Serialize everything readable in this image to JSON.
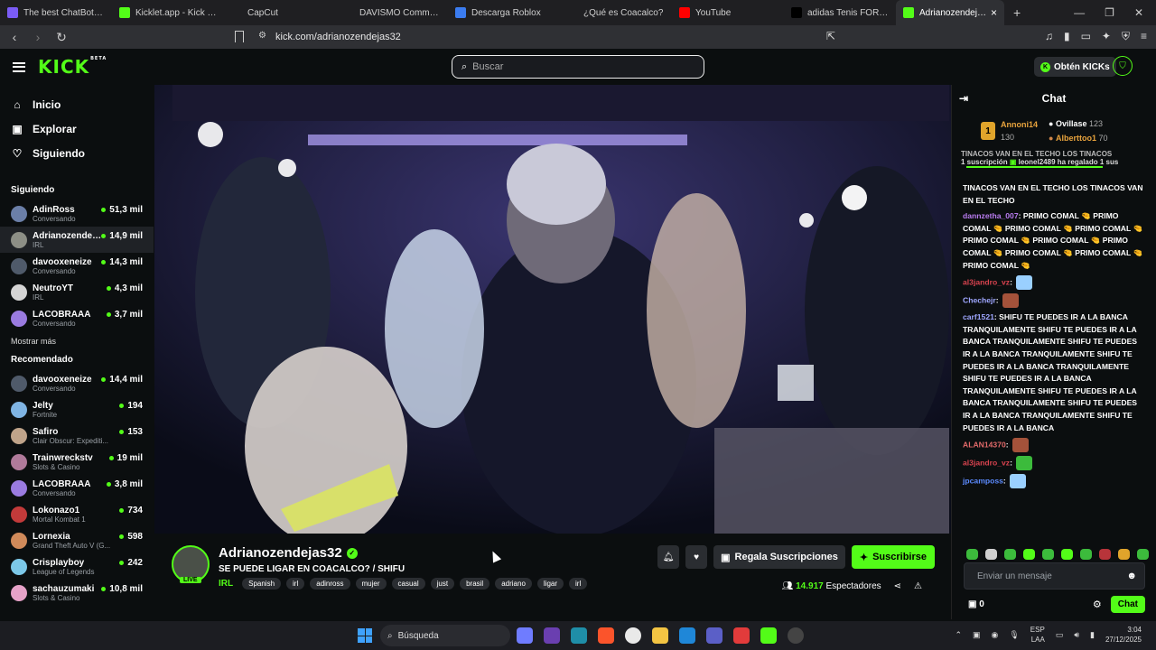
{
  "browser": {
    "tabs": [
      {
        "title": "The best ChatBot and Wi",
        "icon": "chatbot-icon",
        "color": "#7b5cf5"
      },
      {
        "title": "Kicklet.app - Kick Chatbo",
        "icon": "kicklet-icon",
        "color": "#53fc18"
      },
      {
        "title": "CapCut",
        "icon": "capcut-icon",
        "color": "#ffffff"
      },
      {
        "title": "DAVISMO Community / X",
        "icon": "x-icon",
        "color": "#ffffff"
      },
      {
        "title": "Descarga Roblox",
        "icon": "roblox-icon",
        "color": "#3b7cf0"
      },
      {
        "title": "¿Qué es Coacalco?",
        "icon": "ai-icon",
        "color": "#d0d0d0"
      },
      {
        "title": "YouTube",
        "icon": "youtube-icon",
        "color": "#ff0000"
      },
      {
        "title": "adidas Tenis FORUM2000",
        "icon": "adidas-icon",
        "color": "#000000"
      },
      {
        "title": "Adrianozendejas3",
        "icon": "kick-icon",
        "color": "#53fc18",
        "active": true
      }
    ],
    "url": "kick.com/adrianozendejas32"
  },
  "header": {
    "logo": "KICK",
    "logo_sup": "BETA",
    "search_placeholder": "Buscar",
    "get_kicks": "Obtén KICKs"
  },
  "sidebar": {
    "nav": [
      {
        "label": "Inicio",
        "icon": "home-icon"
      },
      {
        "label": "Explorar",
        "icon": "browse-icon"
      },
      {
        "label": "Siguiendo",
        "icon": "heart-icon"
      }
    ],
    "following_title": "Siguiendo",
    "following": [
      {
        "name": "AdinRoss",
        "category": "Conversando",
        "viewers": "51,3 mil",
        "color": "#6b7fa8"
      },
      {
        "name": "Adrianozendejas32",
        "category": "IRL",
        "viewers": "14,9 mil",
        "color": "#8d8f86",
        "selected": true
      },
      {
        "name": "davooxeneize",
        "category": "Conversando",
        "viewers": "14,3 mil",
        "color": "#4f5a6a"
      },
      {
        "name": "NeutroYT",
        "category": "IRL",
        "viewers": "4,3 mil",
        "color": "#d4d4d4"
      },
      {
        "name": "LACOBRAAA",
        "category": "Conversando",
        "viewers": "3,7 mil",
        "color": "#9a7be0"
      }
    ],
    "show_more": "Mostrar más",
    "recommended_title": "Recomendado",
    "recommended": [
      {
        "name": "davooxeneize",
        "category": "Conversando",
        "viewers": "14,4 mil",
        "color": "#4f5a6a"
      },
      {
        "name": "Jelty",
        "category": "Fortnite",
        "viewers": "194",
        "color": "#7fb4e3"
      },
      {
        "name": "Safiro",
        "category": "Clair Obscur: Expediti...",
        "viewers": "153",
        "color": "#c0a48a"
      },
      {
        "name": "Trainwreckstv",
        "category": "Slots & Casino",
        "viewers": "19 mil",
        "color": "#b07a9a"
      },
      {
        "name": "LACOBRAAA",
        "category": "Conversando",
        "viewers": "3,8 mil",
        "color": "#9a7be0"
      },
      {
        "name": "Lokonazo1",
        "category": "Mortal Kombat 1",
        "viewers": "734",
        "color": "#c23a3a"
      },
      {
        "name": "Lornexia",
        "category": "Grand Theft Auto V (G...",
        "viewers": "598",
        "color": "#d08a5a"
      },
      {
        "name": "Crisplayboy",
        "category": "League of Legends",
        "viewers": "242",
        "color": "#7cc8e8"
      },
      {
        "name": "sachauzumaki",
        "category": "Slots & Casino",
        "viewers": "10,8 mil",
        "color": "#e6a2c8"
      }
    ]
  },
  "stream": {
    "streamer": "Adrianozendejas32",
    "live": "LIVE",
    "title": "SE PUEDE LIGAR EN COACALCO? / SHIFU",
    "category": "IRL",
    "tags": [
      "Spanish",
      "irl",
      "adinross",
      "mujer",
      "casual",
      "just",
      "brasil",
      "adriano",
      "ligar",
      "irl"
    ],
    "gift_label": "Regala Suscripciones",
    "subscribe_label": "Suscribirse",
    "viewers": "14.917",
    "viewers_label": "Espectadores"
  },
  "chat": {
    "title": "Chat",
    "leaderboard": {
      "first": {
        "name": "Annoni14",
        "score": "130"
      },
      "second": {
        "name": "Ovillase",
        "score": "123"
      },
      "third": {
        "name": "Alberttoo1",
        "score": "70"
      }
    },
    "pinned_line1": "TINACOS VAN EN EL TECHO LOS TINACOS",
    "pinned_line2a": "1 suscripción",
    "pinned_line2b": "leonel2489 ha regalado 1 sus",
    "messages": [
      {
        "user": "",
        "text": "TINACOS VAN EN EL TECHO LOS TINACOS VAN EN EL TECHO",
        "cls": ""
      },
      {
        "user": "dannzetha_007",
        "text": "PRIMO COMAL 🤏 PRIMO COMAL 🤏 PRIMO COMAL 🤏 PRIMO COMAL 🤏 PRIMO COMAL 🤏 PRIMO COMAL 🤏 PRIMO COMAL 🤏 PRIMO COMAL 🤏 PRIMO COMAL 🤏 PRIMO COMAL 🤏",
        "cls": "u1"
      },
      {
        "user": "al3jandro_vz",
        "text": "",
        "cls": "u2"
      },
      {
        "user": "Chechejr",
        "text": "",
        "cls": "u3"
      },
      {
        "user": "carf1521",
        "text": "SHIFU TE PUEDES IR A LA BANCA TRANQUILAMENTE SHIFU TE PUEDES IR A LA BANCA TRANQUILAMENTE SHIFU TE PUEDES IR A LA BANCA TRANQUILAMENTE SHIFU TE PUEDES IR A LA BANCA TRANQUILAMENTE SHIFU TE PUEDES IR A LA BANCA TRANQUILAMENTE SHIFU TE PUEDES IR A LA BANCA TRANQUILAMENTE SHIFU TE PUEDES IR A LA BANCA TRANQUILAMENTE SHIFU TE PUEDES IR A LA BANCA",
        "cls": "u3"
      },
      {
        "user": "ALAN14370",
        "text": "",
        "cls": "u4"
      },
      {
        "user": "al3jandro_vz",
        "text": "",
        "cls": "u2"
      },
      {
        "user": "jpcamposs",
        "text": "",
        "cls": "u5"
      }
    ],
    "input_placeholder": "Enviar un mensaje",
    "points": "0",
    "chat_button": "Chat"
  },
  "taskbar": {
    "search": "Búsqueda",
    "lang1": "ESP",
    "lang2": "LAA",
    "time": "3:04",
    "date": "27/12/2025"
  }
}
